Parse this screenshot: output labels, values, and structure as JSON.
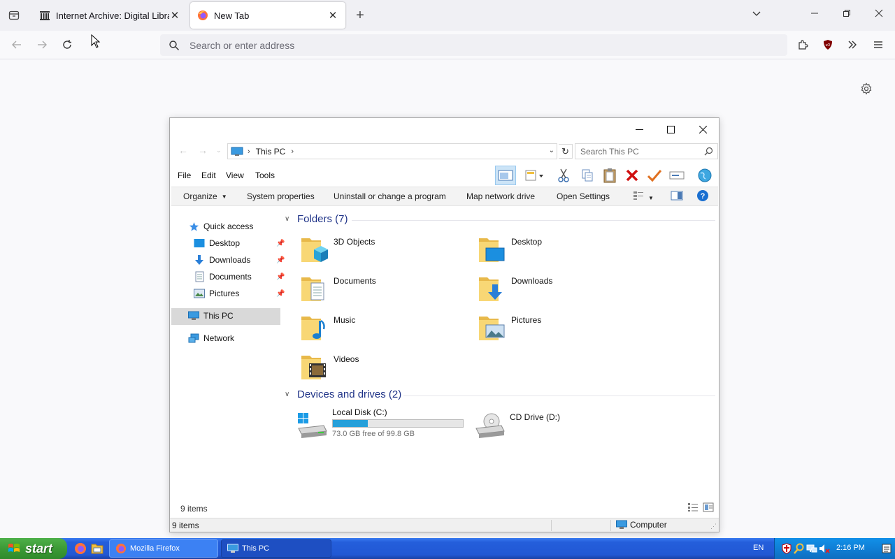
{
  "browser": {
    "tabs": [
      {
        "title": "Internet Archive: Digital Library",
        "active": false
      },
      {
        "title": "New Tab",
        "active": true
      }
    ],
    "url_placeholder": "Search or enter address"
  },
  "explorer": {
    "breadcrumb": "This PC",
    "search_placeholder": "Search This PC",
    "menu": [
      "File",
      "Edit",
      "View",
      "Tools"
    ],
    "commands": {
      "organize": "Organize",
      "system_properties": "System properties",
      "uninstall": "Uninstall or change a program",
      "map_drive": "Map network drive",
      "open_settings": "Open Settings"
    },
    "nav": {
      "quick_access": "Quick access",
      "desktop": "Desktop",
      "downloads": "Downloads",
      "documents": "Documents",
      "pictures": "Pictures",
      "this_pc": "This PC",
      "network": "Network"
    },
    "folders_group": "Folders (7)",
    "folders": [
      "3D Objects",
      "Desktop",
      "Documents",
      "Downloads",
      "Music",
      "Pictures",
      "Videos"
    ],
    "devices_group": "Devices and drives (2)",
    "drives": {
      "c_name": "Local Disk (C:)",
      "c_free": "73.0 GB free of 99.8 GB",
      "c_used_fraction": 0.27,
      "d_name": "CD Drive (D:)"
    },
    "status_items": "9 items",
    "status_bar_items": "9 items",
    "status_zone": "Computer"
  },
  "taskbar": {
    "start": "start",
    "buttons": [
      "Mozilla Firefox",
      "This PC"
    ],
    "lang": "EN",
    "clock": "2:16 PM"
  }
}
